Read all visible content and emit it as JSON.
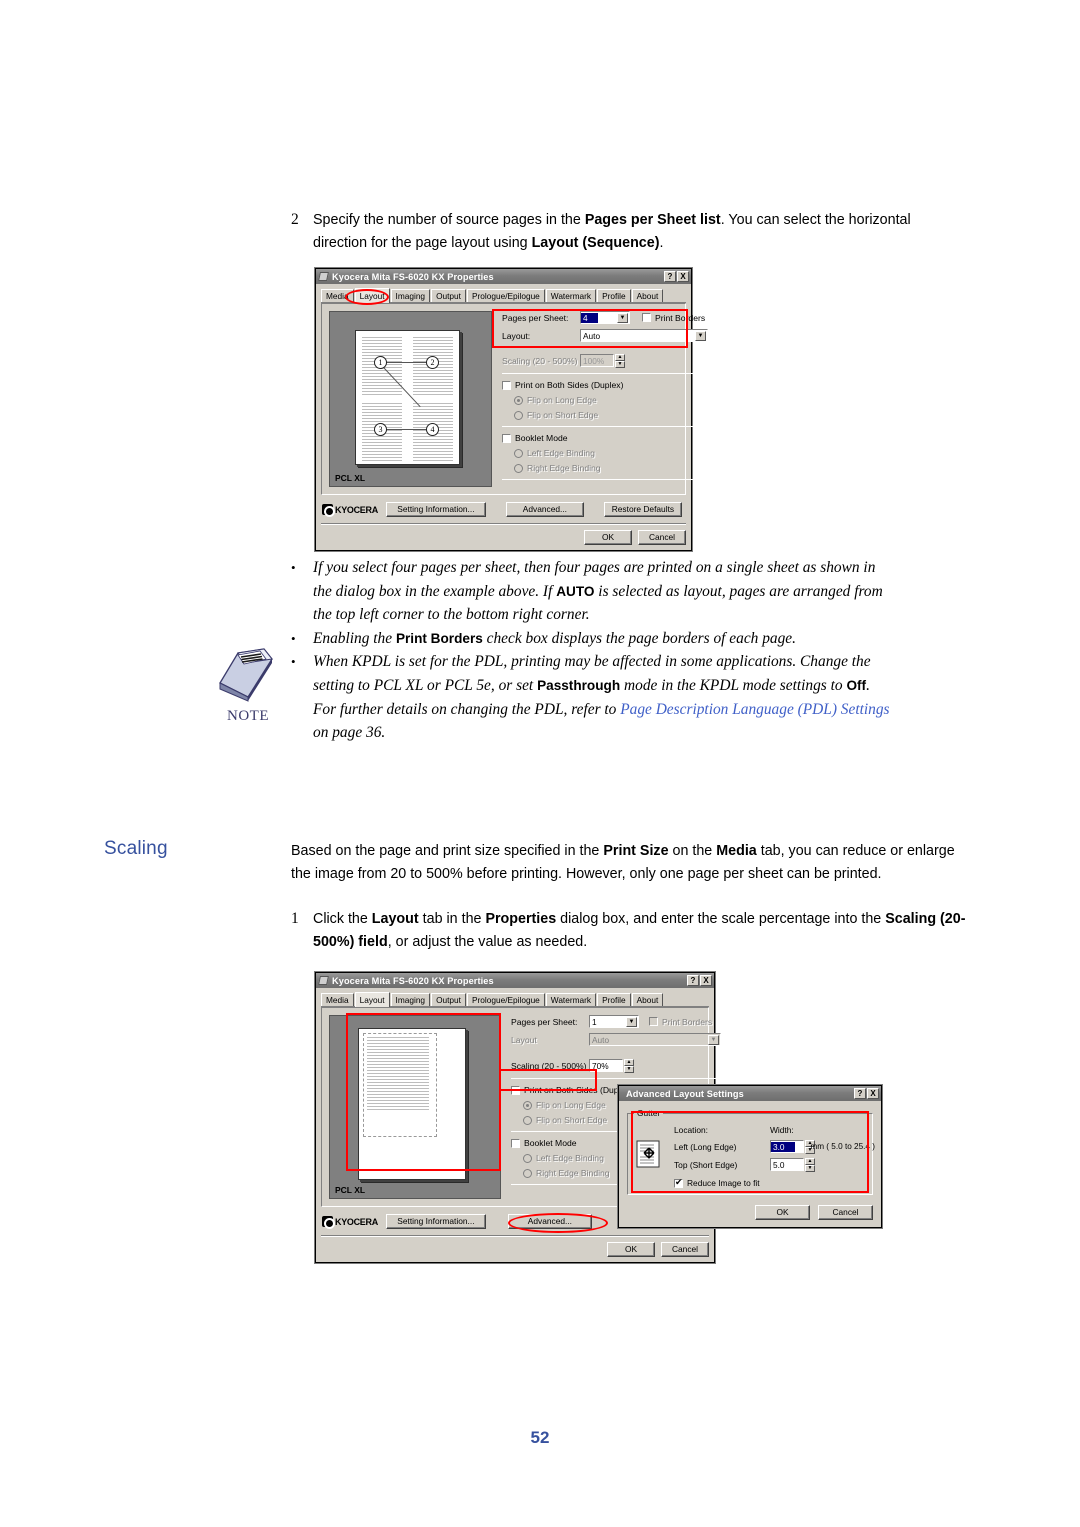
{
  "step2": {
    "number": "2",
    "text_parts": [
      {
        "t": "Specify the number of source pages in the ",
        "b": false
      },
      {
        "t": "Pages per Sheet list",
        "b": true
      },
      {
        "t": ". You can select the horizontal direction for the page layout using ",
        "b": false
      },
      {
        "t": "Layout (Sequence)",
        "b": true
      },
      {
        "t": ".",
        "b": false
      }
    ]
  },
  "dialog1": {
    "title": "Kyocera Mita FS-6020 KX Properties",
    "help_button": "?",
    "close_button": "X",
    "tabs": [
      "Media",
      "Layout",
      "Imaging",
      "Output",
      "Prologue/Epilogue",
      "Watermark",
      "Profile",
      "About"
    ],
    "active_tab": "Layout",
    "preview": {
      "pdl_label": "PCL XL",
      "page_numbers": [
        "1",
        "2",
        "3",
        "4"
      ]
    },
    "controls": {
      "pages_per_sheet_label": "Pages per Sheet:",
      "pages_per_sheet_value": "4",
      "print_borders_label": "Print Borders",
      "print_borders_checked": false,
      "layout_label": "Layout:",
      "layout_value": "Auto",
      "scaling_label": "Scaling (20 - 500%)",
      "scaling_value": "100%",
      "scaling_disabled": true,
      "duplex_label": "Print on Both Sides (Duplex)",
      "flip_long_label": "Flip on Long Edge",
      "flip_short_label": "Flip on Short Edge",
      "booklet_label": "Booklet Mode",
      "left_edge_label": "Left Edge Binding",
      "right_edge_label": "Right Edge Binding"
    },
    "buttons": {
      "brand": "KYOCERA",
      "setting_information": "Setting Information...",
      "advanced": "Advanced...",
      "restore_defaults": "Restore Defaults",
      "ok": "OK",
      "cancel": "Cancel"
    }
  },
  "notes": [
    {
      "bullet": "•",
      "parts": [
        {
          "t": "If you select four pages per sheet, then four pages are printed on a single sheet as shown in the dialog box in the example above. If ",
          "b": false
        },
        {
          "t": "AUTO",
          "b": true
        },
        {
          "t": " is selected as layout, pages are arranged from the top left corner to the bottom right corner.",
          "b": false
        }
      ]
    },
    {
      "bullet": "•",
      "parts": [
        {
          "t": "Enabling the ",
          "b": false
        },
        {
          "t": "Print Borders",
          "b": true
        },
        {
          "t": " check box displays the page borders of each page.",
          "b": false
        }
      ]
    },
    {
      "bullet": "•",
      "parts": [
        {
          "t": "When KPDL is set for the PDL, printing may be affected in some applications. Change the setting to PCL XL or PCL 5e, or set ",
          "b": false
        },
        {
          "t": "Passthrough",
          "b": true
        },
        {
          "t": " mode in the KPDL mode settings to ",
          "b": false
        },
        {
          "t": "Off",
          "b": true
        },
        {
          "t": ". For further details on changing the PDL, refer to ",
          "b": false
        },
        {
          "t": "Page Description Language (PDL) Settings",
          "b": false,
          "link": true
        },
        {
          "t": " on page 36.",
          "b": false
        }
      ]
    }
  ],
  "note_icon_label": "NOTE",
  "section": {
    "heading": "Scaling",
    "intro_parts": [
      {
        "t": "Based on the page and print size specified in the ",
        "b": false
      },
      {
        "t": "Print Size",
        "b": true
      },
      {
        "t": " on the ",
        "b": false
      },
      {
        "t": "Media",
        "b": true
      },
      {
        "t": " tab, you can reduce or enlarge the image from 20 to 500% before printing. However, only one page per sheet can be printed.",
        "b": false
      }
    ],
    "step1_number": "1",
    "step1_parts": [
      {
        "t": "Click the ",
        "b": false
      },
      {
        "t": "Layout",
        "b": true
      },
      {
        "t": " tab in the ",
        "b": false
      },
      {
        "t": "Properties",
        "b": true
      },
      {
        "t": " dialog box, and enter the scale percentage into the ",
        "b": false
      },
      {
        "t": "Scaling (20-500%) field",
        "b": true
      },
      {
        "t": ", or adjust the value as needed.",
        "b": false
      }
    ]
  },
  "dialog2": {
    "title": "Kyocera Mita FS-6020 KX Properties",
    "help_button": "?",
    "close_button": "X",
    "tabs": [
      "Media",
      "Layout",
      "Imaging",
      "Output",
      "Prologue/Epilogue",
      "Watermark",
      "Profile",
      "About"
    ],
    "active_tab": "Layout",
    "preview": {
      "pdl_label": "PCL XL"
    },
    "controls": {
      "pages_per_sheet_label": "Pages per Sheet:",
      "pages_per_sheet_value": "1",
      "print_borders_label": "Print Borders",
      "layout_label": "Layout",
      "layout_value": "Auto",
      "scaling_label": "Scaling (20 - 500%)",
      "scaling_value": "70%",
      "duplex_label": "Print on Both Sides (Duplex)",
      "flip_long_label": "Flip on Long Edge",
      "flip_short_label": "Flip on Short Edge",
      "booklet_label": "Booklet Mode",
      "left_edge_label": "Left Edge Binding",
      "right_edge_label": "Right Edge Binding"
    },
    "buttons": {
      "brand": "KYOCERA",
      "setting_information": "Setting Information...",
      "advanced": "Advanced...",
      "ok": "OK",
      "cancel": "Cancel"
    }
  },
  "dialog3": {
    "title": "Advanced Layout Settings",
    "help_button": "?",
    "close_button": "X",
    "group_label": "Gutter",
    "location_header": "Location:",
    "width_header": "Width:",
    "left_label": "Left (Long Edge)",
    "left_value": "3.0",
    "top_label": "Top (Short Edge)",
    "top_value": "5.0",
    "units_note": "mm ( 5.0 to 25.4 )",
    "reduce_label": "Reduce Image to fit",
    "reduce_checked": true,
    "ok": "OK",
    "cancel": "Cancel"
  },
  "page_number": "52",
  "colors": {
    "heading": "#36519e",
    "link": "#4060c8",
    "highlight": "#ff0000",
    "dialog_face": "#d4d0c8",
    "selection": "#000080"
  }
}
